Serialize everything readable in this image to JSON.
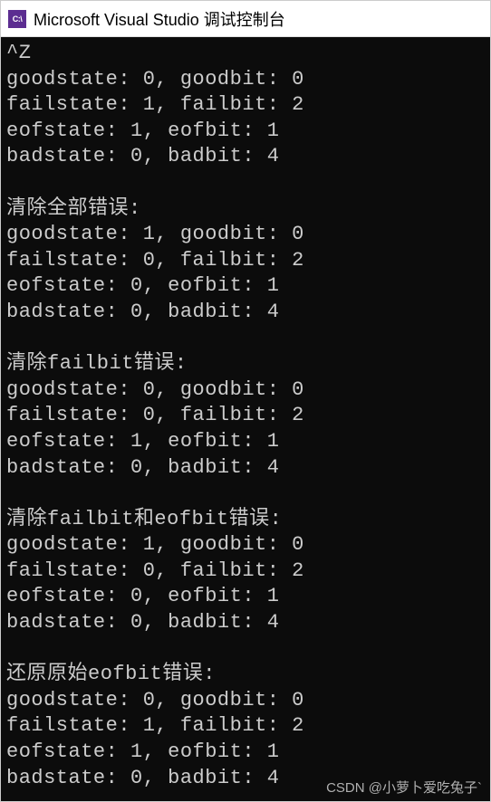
{
  "window": {
    "icon_text": "C:\\",
    "title": "Microsoft Visual Studio 调试控制台"
  },
  "console": {
    "lines": [
      "^Z",
      "goodstate: 0, goodbit: 0",
      "failstate: 1, failbit: 2",
      "eofstate: 1, eofbit: 1",
      "badstate: 0, badbit: 4",
      "",
      "清除全部错误:",
      "goodstate: 1, goodbit: 0",
      "failstate: 0, failbit: 2",
      "eofstate: 0, eofbit: 1",
      "badstate: 0, badbit: 4",
      "",
      "清除failbit错误:",
      "goodstate: 0, goodbit: 0",
      "failstate: 0, failbit: 2",
      "eofstate: 1, eofbit: 1",
      "badstate: 0, badbit: 4",
      "",
      "清除failbit和eofbit错误:",
      "goodstate: 1, goodbit: 0",
      "failstate: 0, failbit: 2",
      "eofstate: 0, eofbit: 1",
      "badstate: 0, badbit: 4",
      "",
      "还原原始eofbit错误:",
      "goodstate: 0, goodbit: 0",
      "failstate: 1, failbit: 2",
      "eofstate: 1, eofbit: 1",
      "badstate: 0, badbit: 4"
    ]
  },
  "watermark": "CSDN @小萝卜爱吃兔子`"
}
